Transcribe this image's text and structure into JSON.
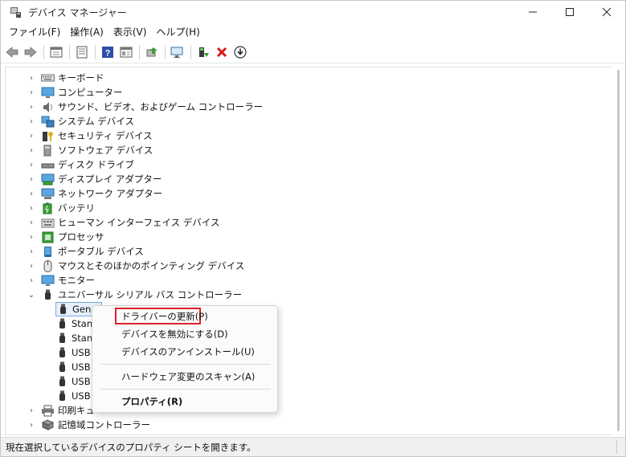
{
  "window": {
    "title": "デバイス マネージャー"
  },
  "menu": [
    "ファイル(F)",
    "操作(A)",
    "表示(V)",
    "ヘルプ(H)"
  ],
  "toolbar_icons": [
    "back-arrow-icon",
    "forward-arrow-icon",
    "properties-sheet-icon",
    "console-tree-icon",
    "help-icon",
    "view-icon",
    "update-driver-icon",
    "monitor-scan-icon",
    "enable-device-icon",
    "uninstall-x-icon",
    "download-circle-icon"
  ],
  "tree": {
    "categories": [
      {
        "label": "キーボード",
        "icon": "keyboard-icon"
      },
      {
        "label": "コンピューター",
        "icon": "computer-icon"
      },
      {
        "label": "サウンド、ビデオ、およびゲーム コントローラー",
        "icon": "speaker-icon"
      },
      {
        "label": "システム デバイス",
        "icon": "system-device-icon"
      },
      {
        "label": "セキュリティ デバイス",
        "icon": "security-key-icon"
      },
      {
        "label": "ソフトウェア デバイス",
        "icon": "software-device-icon"
      },
      {
        "label": "ディスク ドライブ",
        "icon": "disk-drive-icon"
      },
      {
        "label": "ディスプレイ アダプター",
        "icon": "display-adapter-icon"
      },
      {
        "label": "ネットワーク アダプター",
        "icon": "network-adapter-icon"
      },
      {
        "label": "バッテリ",
        "icon": "battery-icon"
      },
      {
        "label": "ヒューマン インターフェイス デバイス",
        "icon": "hid-icon"
      },
      {
        "label": "プロセッサ",
        "icon": "processor-icon"
      },
      {
        "label": "ポータブル デバイス",
        "icon": "portable-device-icon"
      },
      {
        "label": "マウスとそのほかのポインティング デバイス",
        "icon": "mouse-icon"
      },
      {
        "label": "モニター",
        "icon": "monitor-icon"
      },
      {
        "label": "ユニバーサル シリアル バス コントローラー",
        "icon": "usb-icon",
        "expanded": true
      }
    ],
    "usb_children": [
      "Gene",
      "Stand",
      "Stand",
      "USB",
      "USB",
      "USB",
      "USB"
    ],
    "after": [
      {
        "label": "印刷キュー",
        "icon": "printer-icon",
        "visible_text": "印刷キュ"
      },
      {
        "label": "記憶域コントローラー",
        "icon": "storage-controller-icon"
      }
    ]
  },
  "context_menu": {
    "items": [
      {
        "label": "ドライバーの更新(P)",
        "highlighted": true
      },
      {
        "label": "デバイスを無効にする(D)"
      },
      {
        "label": "デバイスのアンインストール(U)"
      },
      {
        "label": "ハードウェア変更のスキャン(A)"
      },
      {
        "label": "プロパティ(R)",
        "bold": true
      }
    ],
    "highlight_color": "#e0202a"
  },
  "status": {
    "text": "現在選択しているデバイスのプロパティ シートを開きます。"
  }
}
